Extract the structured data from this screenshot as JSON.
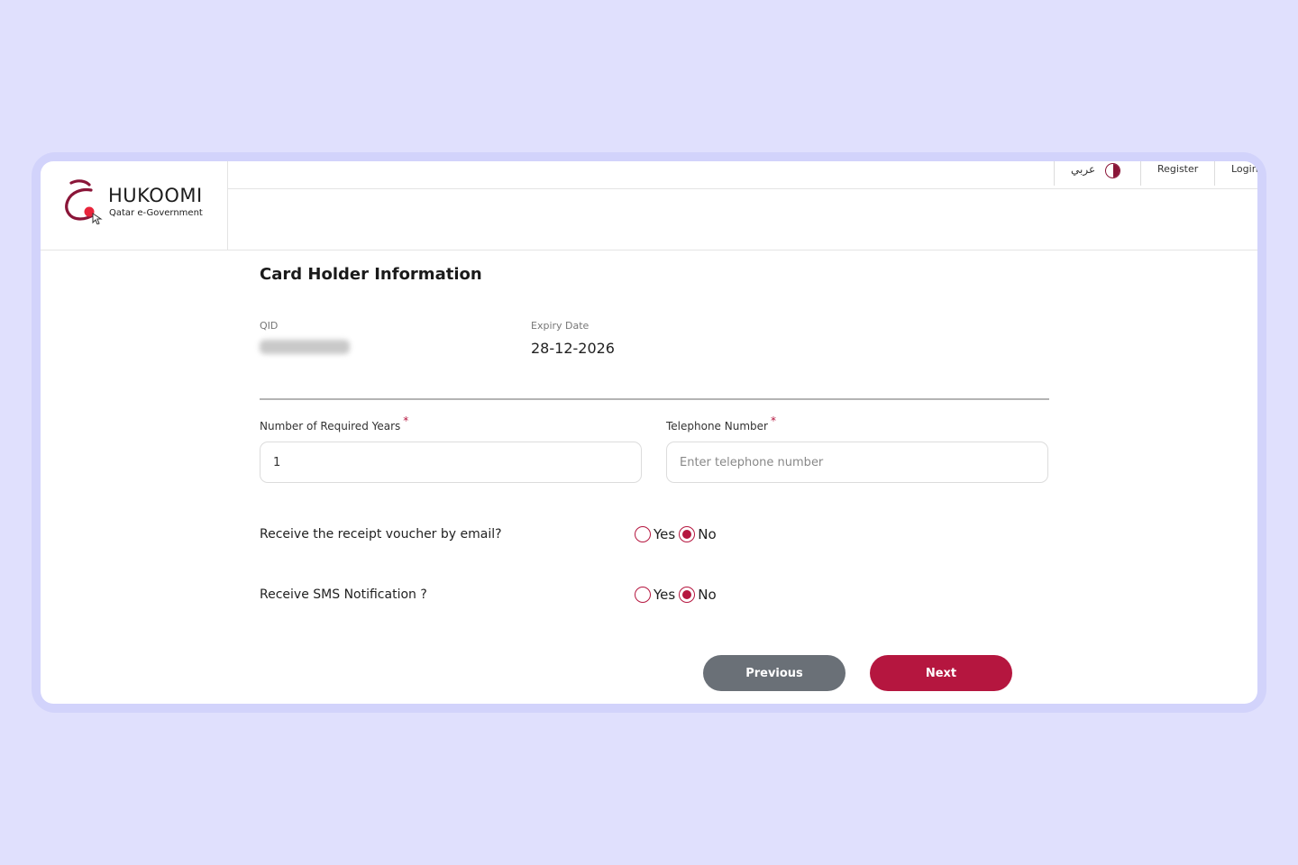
{
  "header": {
    "brand_title": "HUKOOMI",
    "brand_subtitle": "Qatar e-Government",
    "language_toggle": "عربي",
    "register_label": "Register",
    "login_label": "Login"
  },
  "form": {
    "title": "Card Holder Information",
    "qid_label": "QID",
    "expiry_label": "Expiry Date",
    "expiry_value": "28-12-2026",
    "years_label": "Number of Required Years",
    "years_value": "1",
    "phone_label": "Telephone Number",
    "phone_placeholder": "Enter telephone number",
    "required_marker": "*",
    "email_question": "Receive the receipt voucher by email?",
    "sms_question": "Receive SMS Notification ?",
    "yes_label": "Yes",
    "no_label": "No",
    "email_selected": "No",
    "sms_selected": "No"
  },
  "actions": {
    "previous_label": "Previous",
    "next_label": "Next"
  },
  "colors": {
    "accent": "#b5163f",
    "brand_maroon": "#8a1538",
    "secondary_button": "#6a7077",
    "background": "#e0e0fd"
  }
}
